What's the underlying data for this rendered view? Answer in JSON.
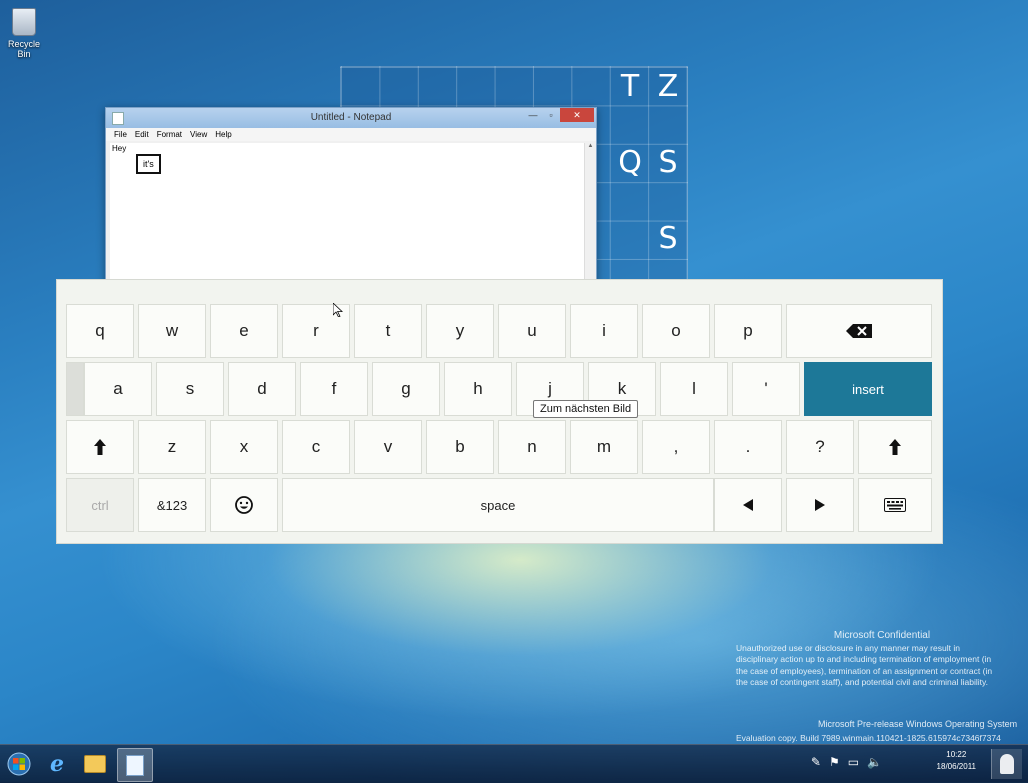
{
  "desktop": {
    "recycle_bin_label": "Recycle Bin"
  },
  "tiles": {
    "letters": [
      "T",
      "Z",
      "Q",
      "S",
      "S"
    ]
  },
  "notepad": {
    "title": "Untitled - Notepad",
    "menu": [
      "File",
      "Edit",
      "Format",
      "View",
      "Help"
    ],
    "text": "Hey",
    "suggestion": "it's",
    "minimize_glyph": "—",
    "maximize_glyph": "▫",
    "close_glyph": "✕"
  },
  "keyboard": {
    "row1": [
      "q",
      "w",
      "e",
      "r",
      "t",
      "y",
      "u",
      "i",
      "o",
      "p"
    ],
    "row2": [
      "a",
      "s",
      "d",
      "f",
      "g",
      "h",
      "j",
      "k",
      "l",
      "'"
    ],
    "row3": [
      "z",
      "x",
      "c",
      "v",
      "b",
      "n",
      "m",
      ",",
      ".",
      "?"
    ],
    "insert_label": "insert",
    "ctrl_label": "ctrl",
    "symbols_label": "&123",
    "space_label": "space",
    "backspace_icon": "backspace-icon",
    "shift_icon": "shift-up-icon",
    "emoji_icon": "emoji-icon",
    "left_arrow_icon": "left-arrow-icon",
    "right_arrow_icon": "right-arrow-icon",
    "keyboard_icon": "keyboard-icon"
  },
  "tooltip": "Zum nächsten Bild",
  "watermark": {
    "title": "Microsoft Confidential",
    "lines": [
      "Unauthorized use or disclosure in any manner may result in",
      "disciplinary action up to and including termination of employment (in",
      "the case of employees), termination of an assignment or contract (in",
      "the case of contingent staff), and potential civil and criminal liability."
    ],
    "os_line": "Microsoft Pre-release Windows Operating System",
    "build_line": "Evaluation copy. Build 7989.winmain.110421-1825.615974c7346f7374"
  },
  "taskbar": {
    "time": "10:22",
    "date": "18/06/2011"
  }
}
